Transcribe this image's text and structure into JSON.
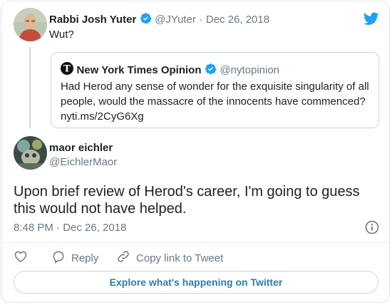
{
  "parent_tweet": {
    "name": "Rabbi Josh Yuter",
    "handle": "@JYuter",
    "separator": "·",
    "date": "Dec 26, 2018",
    "text": "Wut?"
  },
  "quoted_tweet": {
    "name": "New York Times Opinion",
    "handle": "@nytopinion",
    "text_line1": "Had Herod any sense of wonder for the exquisite singularity of all",
    "text_line2": "people, would the massacre of the innocents have commenced?",
    "link": "nyti.ms/2CyG6Xg"
  },
  "main_tweet": {
    "name": "maor eichler",
    "handle": "@EichlerMaor",
    "text_line1": "Upon brief review of Herod's career, I'm going to guess",
    "text_line2": "this would not have helped.",
    "time": "8:48 PM · Dec 26, 2018"
  },
  "actions": {
    "reply": "Reply",
    "copy_link": "Copy link to Tweet"
  },
  "explore_button": "Explore what's happening on Twitter",
  "colors": {
    "twitter_blue": "#1da1f2",
    "link_blue": "#2b7bb9",
    "muted": "#697882"
  },
  "icons": [
    "twitter-bird-icon",
    "verified-badge-icon",
    "nyt-logo-icon",
    "info-icon",
    "heart-icon",
    "reply-icon",
    "link-icon"
  ]
}
